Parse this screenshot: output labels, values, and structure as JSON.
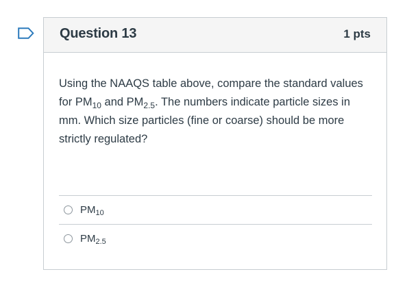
{
  "question": {
    "title": "Question 13",
    "points": "1 pts",
    "text_parts": {
      "p1": "Using the NAAQS table above, compare the standard values for PM",
      "sub1": "10",
      "p2": " and PM",
      "sub2": "2.5",
      "p3": ". The numbers indicate particle sizes in mm. Which size particles (fine or coarse) should be more strictly regulated?"
    }
  },
  "answers": [
    {
      "base": "PM",
      "sub": "10"
    },
    {
      "base": "PM",
      "sub": "2.5"
    }
  ],
  "colors": {
    "flag": "#2b7abc",
    "header_bg": "#f5f5f5",
    "border": "#c7cdd1",
    "text": "#2d3b45"
  },
  "icons": {
    "flag": "bookmark-flag-icon",
    "radio": "radio-button"
  }
}
